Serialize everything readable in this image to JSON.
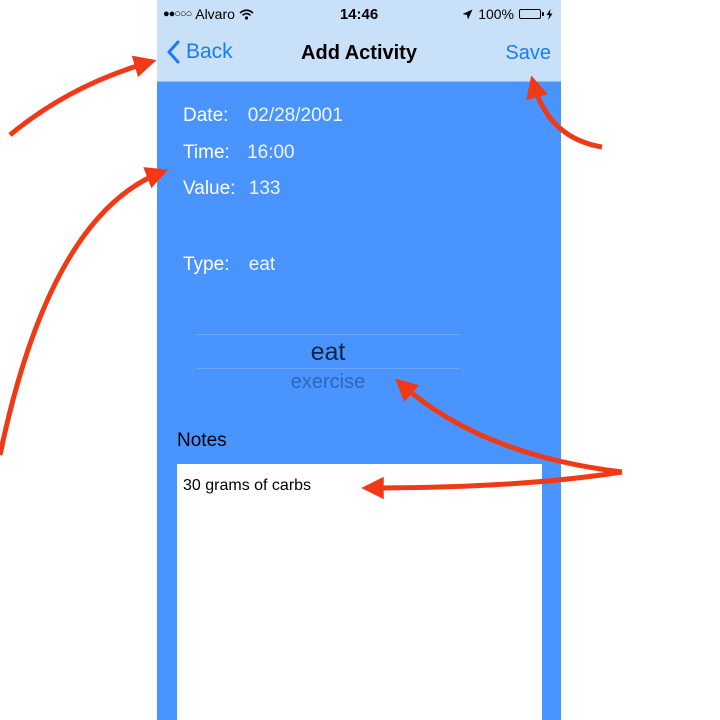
{
  "status_bar": {
    "carrier": "Alvaro",
    "time": "14:46",
    "battery": "100%"
  },
  "nav": {
    "back_label": "Back",
    "title": "Add Activity",
    "save_label": "Save"
  },
  "form": {
    "date_label": "Date:",
    "date_value": "02/28/2001",
    "time_label": "Time:",
    "time_value": "16:00",
    "value_label": "Value:",
    "value_value": "133",
    "type_label": "Type:",
    "type_value": "eat"
  },
  "picker": {
    "selected": "eat",
    "next": "exercise"
  },
  "notes": {
    "label": "Notes",
    "text": "30 grams of carbs"
  },
  "colors": {
    "screen_bg": "#4a94ff",
    "bar_bg": "#c9e1f8",
    "accent": "#1a7cf1",
    "annotation_arrow": "#f03a17"
  }
}
